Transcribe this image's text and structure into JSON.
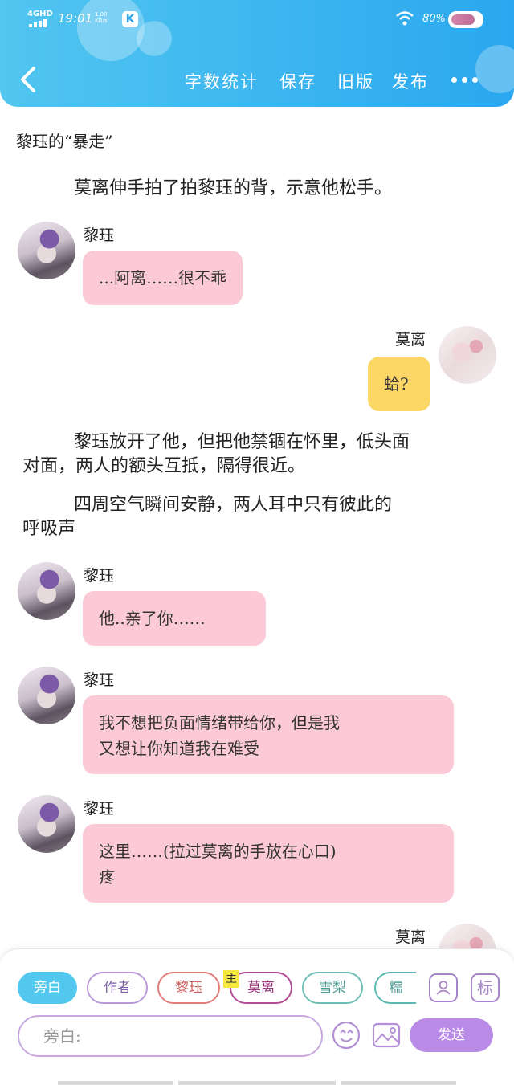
{
  "status_bar": {
    "network": "4GHD",
    "time": "19:01",
    "speed_value": "1.00",
    "speed_unit": "KB/s",
    "app_badge": "K",
    "battery": "80%"
  },
  "header": {
    "nav": [
      "字数统计",
      "保存",
      "旧版",
      "发布"
    ],
    "more_icon": "more-dots-icon",
    "back_icon": "chevron-left-icon"
  },
  "title": "黎珏的“暴走”",
  "items": {
    "narration_1": "莫离伸手拍了拍黎珏的背，示意他松手。",
    "msg_1": {
      "speaker": "黎珏",
      "text": "...阿离……很不乖"
    },
    "msg_2": {
      "speaker": "莫离",
      "text": "蛤?"
    },
    "narration_2_line1": "黎珏放开了他，但把他禁锢在怀里，低头面",
    "narration_2_line2": "对面，两人的额头互抵，隔得很近。",
    "narration_3_line1": "四周空气瞬间安静，两人耳中只有彼此的",
    "narration_3_line2": "呼吸声",
    "msg_3": {
      "speaker": "黎珏",
      "text": "他..亲了你……"
    },
    "msg_4": {
      "speaker": "黎珏",
      "line1": "我不想把负面情绪带给你，但是我",
      "line2": "又想让你知道我在难受"
    },
    "msg_5": {
      "speaker": "黎珏",
      "line1": "这里……(拉过莫离的手放在心口)",
      "line2": "疼"
    },
    "msg_6": {
      "speaker": "莫离"
    }
  },
  "composer": {
    "chips": [
      "旁白",
      "作者",
      "黎珏",
      "莫离",
      "雪梨",
      "糯"
    ],
    "main_mark": "主",
    "side_buttons": [
      "contact-card-icon",
      "标"
    ],
    "input_placeholder": "旁白:",
    "send_label": "发送"
  },
  "colors": {
    "header": "#2aa7ef",
    "pink_bubble": "#fccad7",
    "yellow_bubble": "#fcd766",
    "accent_purple": "#b98be6",
    "chip_active": "#52c8ef"
  }
}
